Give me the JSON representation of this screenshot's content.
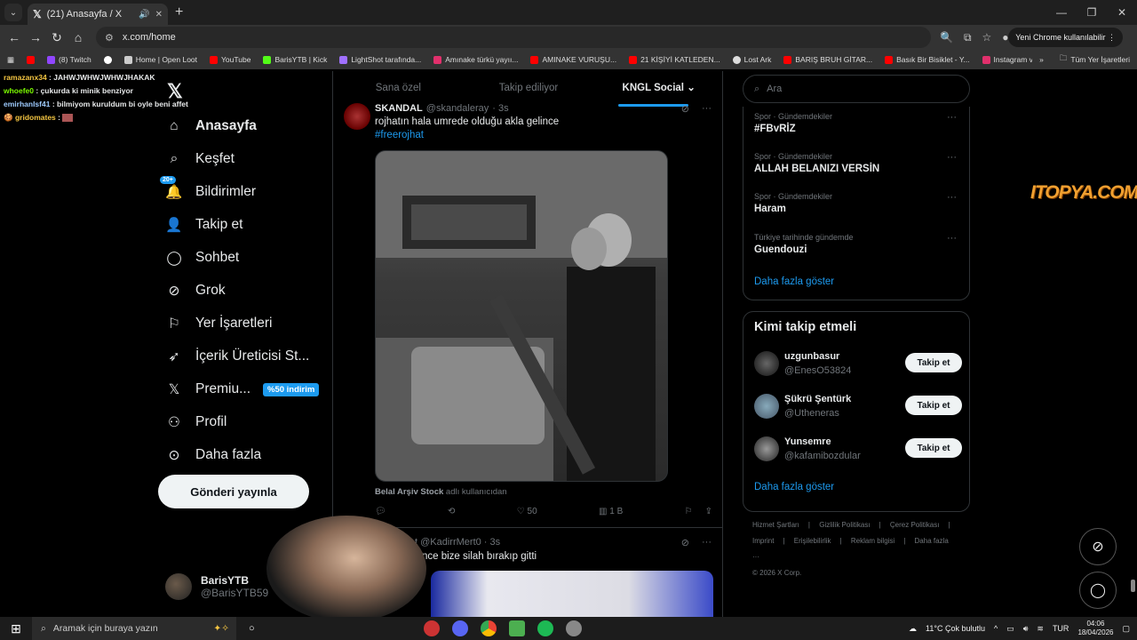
{
  "browser": {
    "tab_title": "(21) Anasayfa / X",
    "url": "x.com/home",
    "update_button": "Yeni Chrome kullanılabilir",
    "bookmarks": [
      {
        "label": "(8) Twitch",
        "color": "#9146ff"
      },
      {
        "label": "",
        "color": "#ffffff"
      },
      {
        "label": "Home | Open Loot",
        "color": "#cccccc"
      },
      {
        "label": "YouTube",
        "color": "#ff0000"
      },
      {
        "label": "BarisYTB | Kick",
        "color": "#53fc18"
      },
      {
        "label": "LightShot tarafında...",
        "color": "#a070ff"
      },
      {
        "label": "Amınake türkü yayıı...",
        "color": "#e1306c"
      },
      {
        "label": "AMINAKE VURUŞU...",
        "color": "#ff0000"
      },
      {
        "label": "21 KİŞİYİ KATLEDEN...",
        "color": "#ff0000"
      },
      {
        "label": "Lost Ark",
        "color": "#dddddd"
      },
      {
        "label": "BARIŞ BRUH GİTAR...",
        "color": "#ff0000"
      },
      {
        "label": "Basık Bir Bisiklet - Y...",
        "color": "#ff0000"
      },
      {
        "label": "Instagram videosu...",
        "color": "#e1306c"
      }
    ],
    "bookmarks_all": "Tüm Yer İşaretleri"
  },
  "chat": [
    {
      "name": "ramazanx34",
      "color": "#f4c542",
      "msg": "JAHWJWHWJWHWJHAKAK"
    },
    {
      "name": "whoefe0",
      "color": "#7cfc00",
      "msg": "çukurda ki minik benziyor"
    },
    {
      "name": "emirhanlsf41",
      "color": "#9ecbff",
      "msg": "bilmiyom kuruldum bi oyle beni affet"
    },
    {
      "name": "gridomates",
      "color": "#f4c542",
      "msg": ""
    }
  ],
  "nav": {
    "badge": "20+",
    "items": [
      "Anasayfa",
      "Keşfet",
      "Bildirimler",
      "Takip et",
      "Sohbet",
      "Grok",
      "Yer İşaretleri",
      "İçerik Üreticisi St...",
      "Premiu...",
      "Profil",
      "Daha fazla"
    ],
    "promo": "%50 indirim",
    "post_button": "Gönderi yayınla",
    "account_name": "BarisYTB",
    "account_handle": "@BarisYTB59"
  },
  "timeline": {
    "tabs": [
      "Sana özel",
      "Takip ediliyor",
      "KNGL Social"
    ],
    "tweet1": {
      "name": "SKANDAL",
      "handle": "@skandaleray",
      "time": "· 3s",
      "text": "rojhatın hala umrede olduğu akla gelince",
      "hashtag": "#freerojhat",
      "credit_name": "Belal Arşiv Stock",
      "credit_suffix": "adlı kullanıcıdan",
      "likes": "50",
      "views": "1 B"
    },
    "tweet2": {
      "handle_time": "t @KadirrMert0 · 3s",
      "text": "n önce bize silah bırakıp gitti"
    }
  },
  "right": {
    "search_placeholder": "Ara",
    "trends": [
      {
        "meta": "Spor · Gündemdekiler",
        "title": "#FBvRİZ"
      },
      {
        "meta": "Spor · Gündemdekiler",
        "title": "ALLAH BELANIZI VERSİN"
      },
      {
        "meta": "Spor · Gündemdekiler",
        "title": "Haram"
      },
      {
        "meta": "Türkiye tarihinde gündemde",
        "title": "Guendouzi"
      }
    ],
    "show_more": "Daha fazla göster",
    "wtf_title": "Kimi takip etmeli",
    "who": [
      {
        "name": "uzgunbasur",
        "handle": "@EnesO53824",
        "button": "Takip et"
      },
      {
        "name": "Şükrü Şentürk",
        "handle": "@Utheneras",
        "button": "Takip et"
      },
      {
        "name": "Yunsemre",
        "handle": "@kafamibozdular",
        "button": "Takip et"
      }
    ],
    "show_more2": "Daha fazla göster",
    "footer": [
      "Hizmet Şartları",
      "Gizlilik Politikası",
      "Çerez Politikası",
      "Imprint",
      "Erişilebilirlik",
      "Reklam bilgisi",
      "Daha fazla ···",
      "© 2026 X Corp."
    ]
  },
  "watermark": "ITOPYA.COM",
  "taskbar": {
    "search_placeholder": "Aramak için buraya yazın",
    "weather": "11°C  Çok bulutlu",
    "lang": "TUR",
    "time": "04:06",
    "date": "18/04/2026"
  }
}
